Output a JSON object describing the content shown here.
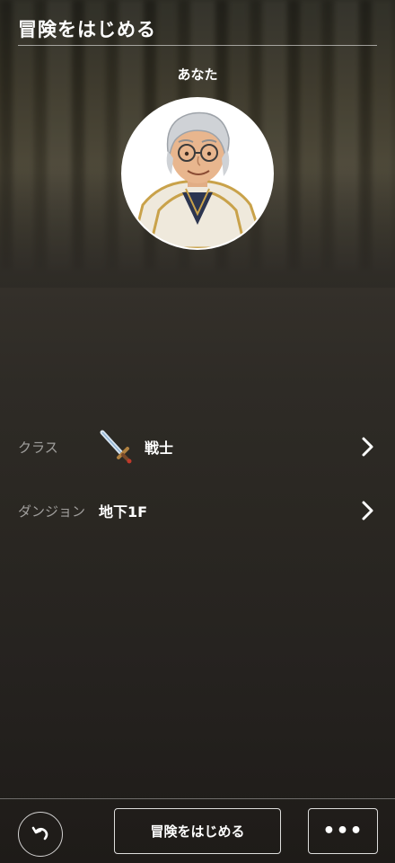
{
  "header": {
    "title": "冒険をはじめる"
  },
  "player": {
    "label": "あなた",
    "portrait_icon": "elder-mage-portrait"
  },
  "settings": {
    "class": {
      "label": "クラス",
      "value": "戦士",
      "icon": "sword-icon"
    },
    "dungeon": {
      "label": "ダンジョン",
      "value": "地下1F"
    }
  },
  "footer": {
    "undo_icon": "undo-icon",
    "start_label": "冒険をはじめる",
    "more_label": "•••"
  },
  "colors": {
    "text": "#ffffff",
    "muted_label": "#9a968e",
    "background_top": "#3a3628",
    "background_bottom": "#1e1b18"
  }
}
